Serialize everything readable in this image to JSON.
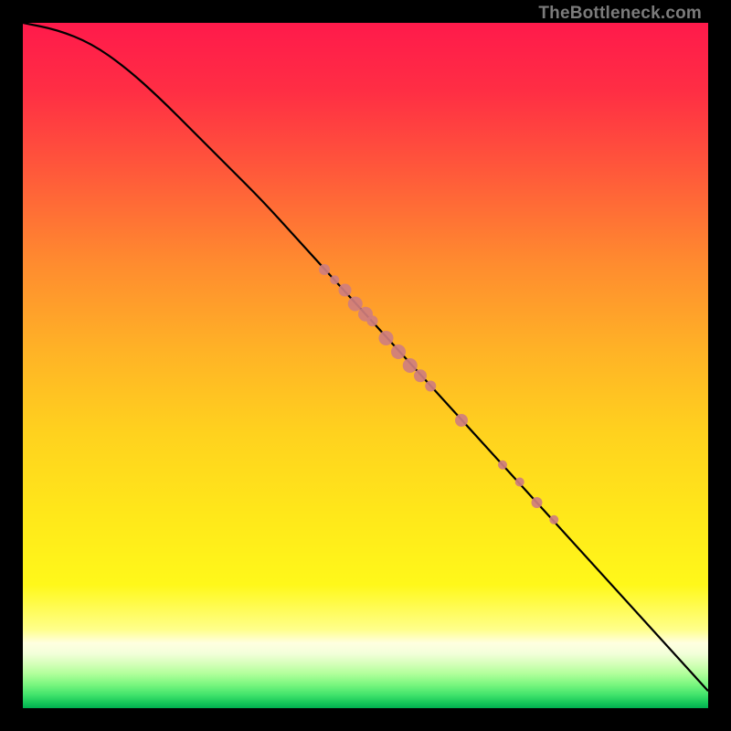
{
  "watermark": "TheBottleneck.com",
  "chart_data": {
    "type": "line",
    "title": "",
    "xlabel": "",
    "ylabel": "",
    "xlim": [
      0,
      100
    ],
    "ylim": [
      0,
      100
    ],
    "grid": false,
    "curve": [
      {
        "x": 0,
        "y": 100
      },
      {
        "x": 5,
        "y": 99
      },
      {
        "x": 10,
        "y": 97
      },
      {
        "x": 15,
        "y": 93.5
      },
      {
        "x": 20,
        "y": 89
      },
      {
        "x": 25,
        "y": 84
      },
      {
        "x": 30,
        "y": 79
      },
      {
        "x": 35,
        "y": 74
      },
      {
        "x": 40,
        "y": 68.5
      },
      {
        "x": 45,
        "y": 63
      },
      {
        "x": 50,
        "y": 57.5
      },
      {
        "x": 55,
        "y": 52
      },
      {
        "x": 60,
        "y": 46.5
      },
      {
        "x": 65,
        "y": 41
      },
      {
        "x": 70,
        "y": 35.5
      },
      {
        "x": 75,
        "y": 30
      },
      {
        "x": 80,
        "y": 24.5
      },
      {
        "x": 85,
        "y": 19
      },
      {
        "x": 90,
        "y": 13.5
      },
      {
        "x": 95,
        "y": 8
      },
      {
        "x": 100,
        "y": 2.5
      }
    ],
    "markers": [
      {
        "x": 44,
        "y": 64,
        "r": 6
      },
      {
        "x": 45.5,
        "y": 62.5,
        "r": 5
      },
      {
        "x": 47,
        "y": 61,
        "r": 7
      },
      {
        "x": 48.5,
        "y": 59,
        "r": 8
      },
      {
        "x": 50,
        "y": 57.5,
        "r": 8
      },
      {
        "x": 51,
        "y": 56.5,
        "r": 6
      },
      {
        "x": 53,
        "y": 54,
        "r": 8
      },
      {
        "x": 54.8,
        "y": 52,
        "r": 8
      },
      {
        "x": 56.5,
        "y": 50,
        "r": 8
      },
      {
        "x": 58,
        "y": 48.5,
        "r": 7
      },
      {
        "x": 59.5,
        "y": 47,
        "r": 6
      },
      {
        "x": 64,
        "y": 42,
        "r": 7
      },
      {
        "x": 70,
        "y": 35.5,
        "r": 5
      },
      {
        "x": 72.5,
        "y": 33,
        "r": 5
      },
      {
        "x": 75,
        "y": 30,
        "r": 6
      },
      {
        "x": 77.5,
        "y": 27.5,
        "r": 5
      }
    ],
    "gradient_stops": [
      {
        "offset": 0.0,
        "color": "#ff1a4b"
      },
      {
        "offset": 0.1,
        "color": "#ff2e44"
      },
      {
        "offset": 0.22,
        "color": "#ff5a3a"
      },
      {
        "offset": 0.35,
        "color": "#ff8b2f"
      },
      {
        "offset": 0.48,
        "color": "#ffb326"
      },
      {
        "offset": 0.6,
        "color": "#ffd21e"
      },
      {
        "offset": 0.72,
        "color": "#ffe81a"
      },
      {
        "offset": 0.82,
        "color": "#fff81a"
      },
      {
        "offset": 0.885,
        "color": "#ffff8a"
      },
      {
        "offset": 0.905,
        "color": "#ffffe0"
      },
      {
        "offset": 0.92,
        "color": "#f3ffda"
      },
      {
        "offset": 0.935,
        "color": "#d6ffba"
      },
      {
        "offset": 0.95,
        "color": "#b0ff9a"
      },
      {
        "offset": 0.965,
        "color": "#7cf780"
      },
      {
        "offset": 0.98,
        "color": "#44e46c"
      },
      {
        "offset": 0.992,
        "color": "#16c85a"
      },
      {
        "offset": 1.0,
        "color": "#00b050"
      }
    ],
    "marker_color": "#cf7e7e",
    "curve_color": "#000000"
  }
}
